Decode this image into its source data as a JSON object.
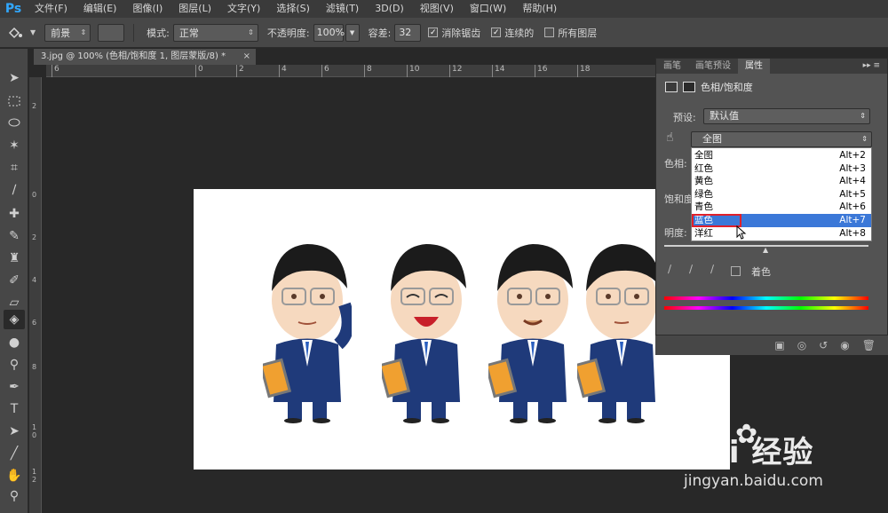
{
  "app": {
    "logo": "Ps"
  },
  "menu": [
    "文件(F)",
    "编辑(E)",
    "图像(I)",
    "图层(L)",
    "文字(Y)",
    "选择(S)",
    "滤镜(T)",
    "3D(D)",
    "视图(V)",
    "窗口(W)",
    "帮助(H)"
  ],
  "options": {
    "fill_source": "前景",
    "mode_label": "模式:",
    "mode_value": "正常",
    "opacity_label": "不透明度:",
    "opacity_value": "100%",
    "tolerance_label": "容差:",
    "tolerance_value": "32",
    "antialias_label": "消除锯齿",
    "contiguous_label": "连续的",
    "all_layers_label": "所有图层"
  },
  "document": {
    "tab_title": "3.jpg @ 100% (色相/饱和度 1, 图层蒙版/8) *",
    "close_glyph": "×"
  },
  "rulers": {
    "top": [
      "6",
      "0",
      "2",
      "4",
      "6",
      "8",
      "10",
      "12",
      "14",
      "16",
      "18"
    ],
    "left": [
      "2",
      "0",
      "2",
      "4",
      "6",
      "8",
      "1 0",
      "1 2"
    ]
  },
  "panel": {
    "tabs": [
      "画笔",
      "画笔预设",
      "属性"
    ],
    "active_tab": "属性",
    "menu_glyph": "▸▸ ≡",
    "title": "色相/饱和度",
    "preset_label": "预设:",
    "preset_value": "默认值",
    "channel_value": "全图",
    "hue_label": "色相:",
    "saturation_label": "饱和度:",
    "lightness_label": "明度:",
    "colorize_label": "着色"
  },
  "dropdown": {
    "items": [
      {
        "label": "全图",
        "shortcut": "Alt+2"
      },
      {
        "label": "红色",
        "shortcut": "Alt+3"
      },
      {
        "label": "黄色",
        "shortcut": "Alt+4"
      },
      {
        "label": "绿色",
        "shortcut": "Alt+5"
      },
      {
        "label": "青色",
        "shortcut": "Alt+6"
      },
      {
        "label": "蓝色",
        "shortcut": "Alt+7"
      },
      {
        "label": "洋红",
        "shortcut": "Alt+8"
      }
    ],
    "selected_index": 5
  },
  "watermark": {
    "brand": "Bai 经验",
    "url": "jingyan.baidu.com"
  },
  "colors": {
    "accent": "#31a8ff",
    "selection": "#3b78d8",
    "highlight_box": "#e0202a",
    "suit": "#1f3a7a"
  }
}
